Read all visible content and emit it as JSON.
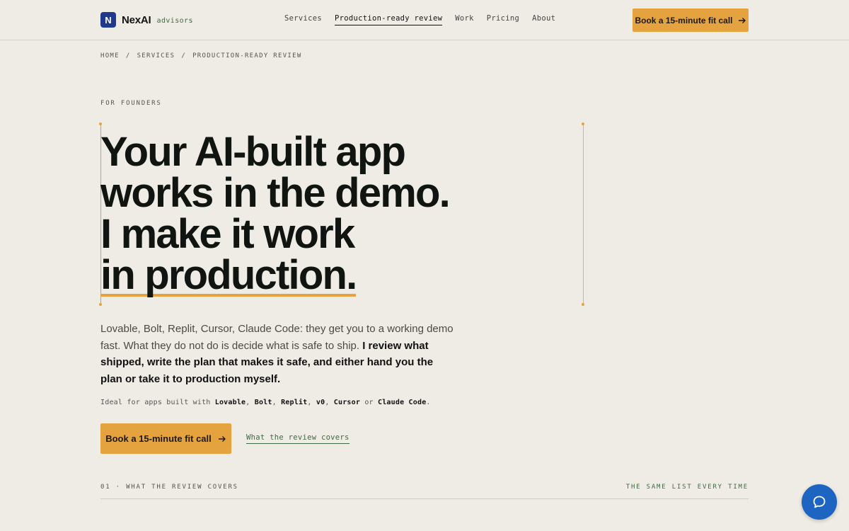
{
  "brand": {
    "logo_letter": "N",
    "name": "NexAI",
    "sub": "advisors"
  },
  "nav": {
    "items": [
      {
        "label": "Services"
      },
      {
        "label": "Production-ready review",
        "active": true
      },
      {
        "label": "Work"
      },
      {
        "label": "Pricing"
      },
      {
        "label": "About"
      }
    ]
  },
  "header_cta": {
    "label": "Book a 15-minute fit call",
    "icon": "arrow-right-icon"
  },
  "breadcrumb": [
    "HOME",
    "SERVICES",
    "PRODUCTION-READY REVIEW"
  ],
  "breadcrumb_sep": "/",
  "hero": {
    "eyebrow": "FOR FOUNDERS",
    "headline_lines": [
      "Your AI-built app",
      "works in the demo.",
      "I make it work",
      "in production."
    ],
    "lede_plain": "Lovable, Bolt, Replit, Cursor, Claude Code: they get you to a working demo fast. What they do not do is decide what is safe to ship. ",
    "lede_bold": "I review what shipped, write the plan that makes it safe, and either hand you the plan or take it to production myself.",
    "ideal_prefix": "Ideal for apps built with ",
    "ideal_tools": [
      "Lovable",
      "Bolt",
      "Replit",
      "v0",
      "Cursor",
      "Claude Code"
    ],
    "ideal_sep_comma": ", ",
    "ideal_sep_or": " or ",
    "ideal_end": "."
  },
  "cta_main": {
    "label": "Book a 15-minute fit call",
    "icon": "arrow-right-icon"
  },
  "secondary_link": {
    "label": "What the review covers"
  },
  "section": {
    "left": "01 · WHAT THE REVIEW COVERS",
    "right": "THE SAME LIST EVERY TIME"
  },
  "chat": {
    "icon": "chat-bubble-icon"
  },
  "colors": {
    "background": "#efece5",
    "accent": "#e5a33f",
    "brand_blue": "#1f3a8c",
    "green": "#3f6a40",
    "chat_blue": "#1d65c1"
  }
}
